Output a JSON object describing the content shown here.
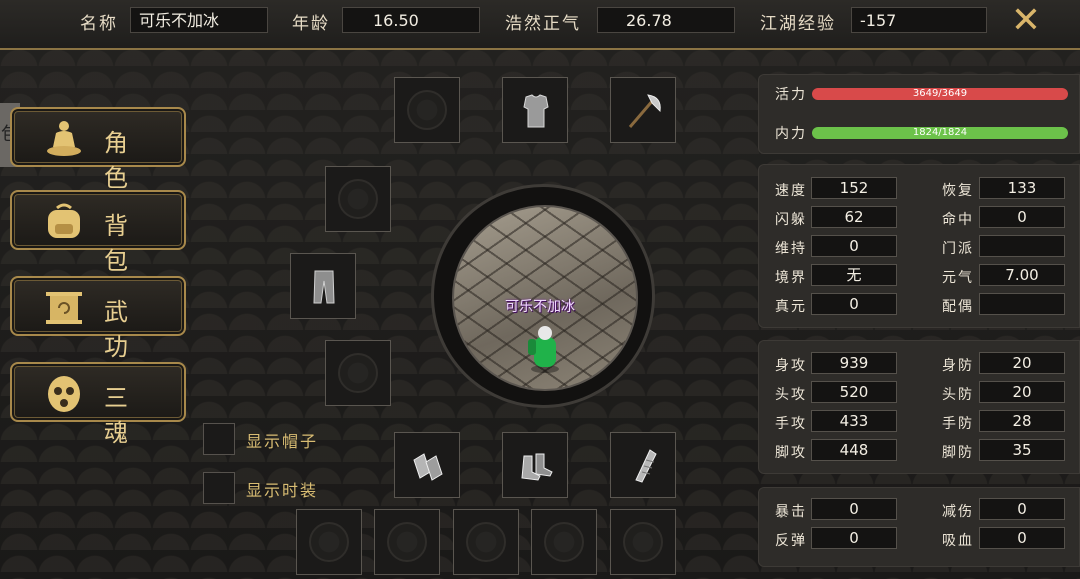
{
  "header": {
    "name_label": "名称",
    "name_value": "可乐不加冰",
    "age_label": "年龄",
    "age_value": "16.50",
    "righteous_label": "浩然正气",
    "righteous_value": "26.78",
    "exp_label": "江湖经验",
    "exp_value": "-157",
    "close_symbol": "✕"
  },
  "side_tab": "包",
  "menu": [
    {
      "label": "角色",
      "icon": "meditating-figure-icon"
    },
    {
      "label": "背包",
      "icon": "backpack-icon"
    },
    {
      "label": "武功",
      "icon": "scroll-icon"
    },
    {
      "label": "三魂",
      "icon": "mask-icon"
    }
  ],
  "character": {
    "name": "可乐不加冰"
  },
  "toggles": {
    "hat": "显示帽子",
    "fashion": "显示时装"
  },
  "vitals": {
    "hp_label": "活力",
    "hp_text": "3649/3649",
    "hp_fill": 1.0,
    "hp_color": "#d84a4a",
    "mp_label": "内力",
    "mp_text": "1824/1824",
    "mp_fill": 1.0,
    "mp_color": "#6cc24a"
  },
  "stats1": {
    "speed_label": "速度",
    "speed": "152",
    "recover_label": "恢复",
    "recover": "133",
    "dodge_label": "闪躲",
    "dodge": "62",
    "hit_label": "命中",
    "hit": "0",
    "sustain_label": "维持",
    "sustain": "0",
    "sect_label": "门派",
    "sect": "",
    "realm_label": "境界",
    "realm": "无",
    "qi_label": "元气",
    "qi": "7.00",
    "true_label": "真元",
    "true_val": "0",
    "spouse_label": "配偶",
    "spouse": ""
  },
  "stats2": {
    "body_atk_label": "身攻",
    "body_atk": "939",
    "body_def_label": "身防",
    "body_def": "20",
    "head_atk_label": "头攻",
    "head_atk": "520",
    "head_def_label": "头防",
    "head_def": "20",
    "hand_atk_label": "手攻",
    "hand_atk": "433",
    "hand_def_label": "手防",
    "hand_def": "28",
    "foot_atk_label": "脚攻",
    "foot_atk": "448",
    "foot_def_label": "脚防",
    "foot_def": "35"
  },
  "stats3": {
    "crit_label": "暴击",
    "crit": "0",
    "reduce_label": "减伤",
    "reduce": "0",
    "reflect_label": "反弹",
    "reflect": "0",
    "leech_label": "吸血",
    "leech": "0"
  }
}
